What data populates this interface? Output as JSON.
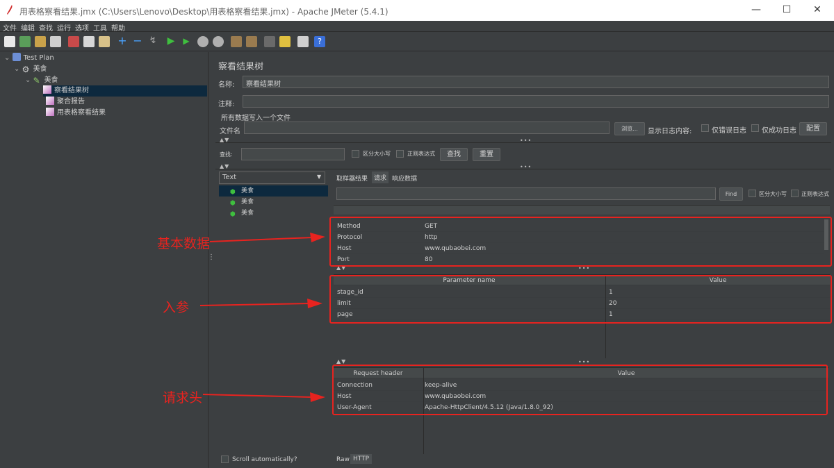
{
  "window": {
    "title": "用表格察看结果.jmx (C:\\Users\\Lenovo\\Desktop\\用表格察看结果.jmx) - Apache JMeter (5.4.1)",
    "minimize": "—",
    "maximize": "☐",
    "close": "✕"
  },
  "menu": [
    "文件",
    "编辑",
    "查找",
    "运行",
    "选项",
    "工具",
    "帮助"
  ],
  "tree": {
    "nodes": [
      {
        "label": "Test Plan",
        "icon": "flask-icon"
      },
      {
        "label": "美食",
        "icon": "gear-icon"
      },
      {
        "label": "美食",
        "icon": "pen-icon"
      },
      {
        "label": "察看结果树",
        "icon": "chart-icon"
      },
      {
        "label": "聚合报告",
        "icon": "chart-icon"
      },
      {
        "label": "用表格察看结果",
        "icon": "chart-icon"
      }
    ]
  },
  "panel": {
    "title": "察看结果树",
    "name_label": "名称:",
    "name_value": "察看结果树",
    "comment_label": "注释:",
    "write_all_label": "所有数据写入一个文件",
    "filename_label": "文件名",
    "browse": "浏览...",
    "log_display": "显示日志内容:",
    "errors_only": "仅错误日志",
    "success_only": "仅成功日志",
    "config": "配置",
    "search_label": "查找:",
    "case_sensitive": "区分大小写",
    "regex": "正则表达式",
    "search_btn": "查找",
    "reset_btn": "重置"
  },
  "results": {
    "renderer": "Text",
    "samples": [
      "美食",
      "美食",
      "美食"
    ],
    "tabs": [
      "取样器结果",
      "请求",
      "响应数据"
    ],
    "find_btn": "Find",
    "find_case": "区分大小写",
    "find_regex": "正则表达式",
    "scroll_auto": "Scroll automatically?",
    "bottom_tabs": [
      "Raw",
      "HTTP"
    ]
  },
  "basic": [
    {
      "k": "Method",
      "v": "GET"
    },
    {
      "k": "Protocol",
      "v": "http"
    },
    {
      "k": "Host",
      "v": "www.qubaobei.com"
    },
    {
      "k": "Port",
      "v": "80"
    }
  ],
  "params": {
    "headers": [
      "Parameter name",
      "Value"
    ],
    "rows": [
      {
        "k": "stage_id",
        "v": "1"
      },
      {
        "k": "limit",
        "v": "20"
      },
      {
        "k": "page",
        "v": "1"
      }
    ]
  },
  "req_headers": {
    "headers": [
      "Request header",
      "Value"
    ],
    "rows": [
      {
        "k": "Connection",
        "v": "keep-alive"
      },
      {
        "k": "Host",
        "v": "www.qubaobei.com"
      },
      {
        "k": "User-Agent",
        "v": "Apache-HttpClient/4.5.12 (Java/1.8.0_92)"
      }
    ]
  },
  "annotations": {
    "basic": "基本数据",
    "params": "入参",
    "headers": "请求头"
  },
  "colors": {
    "accent_red": "#e8231f",
    "bg": "#3c3f41",
    "selection": "#0d293e"
  }
}
